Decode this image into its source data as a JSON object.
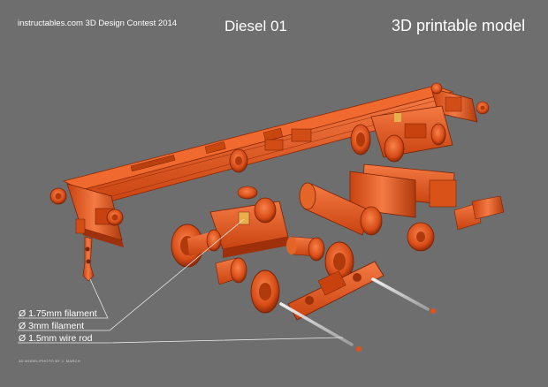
{
  "header": {
    "contest": "instructables.com 3D Design Contest 2014",
    "title": "Diesel 01",
    "subtitle": "3D printable model"
  },
  "callouts": [
    "Ø 1.75mm filament",
    "Ø 3mm filament",
    "Ø 1.5mm wire rod"
  ],
  "credit": "3D MODEL/PHOTO BY J. MARCH",
  "colors": {
    "background": "#6e6e6e",
    "part": "#e0521a",
    "part_dark": "#9a2f0c",
    "part_light": "#f4703a",
    "rod": "#d2d2d2",
    "text": "#ffffff"
  }
}
